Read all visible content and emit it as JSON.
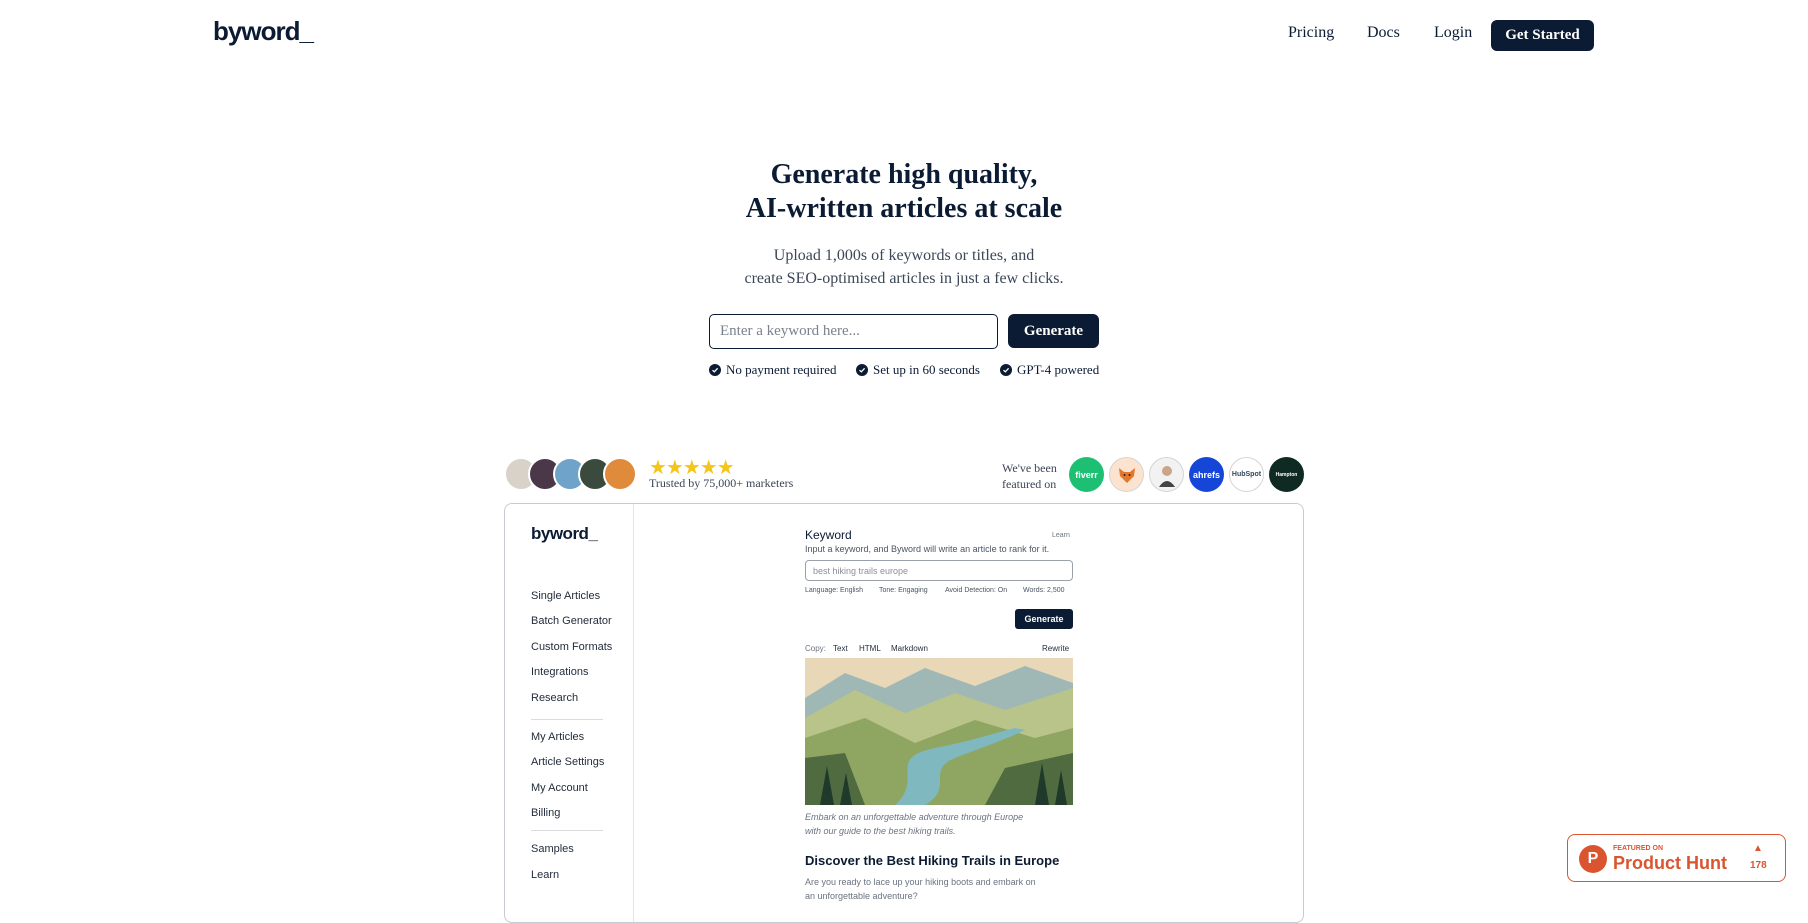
{
  "header": {
    "logo": "byword_",
    "nav": {
      "pricing": "Pricing",
      "docs": "Docs",
      "login": "Login"
    },
    "cta": "Get Started"
  },
  "hero": {
    "title_line1": "Generate high quality,",
    "title_line2": "AI-written articles at scale",
    "subtitle_line1": "Upload 1,000s of keywords or titles, and",
    "subtitle_line2": "create SEO-optimised articles in just a few clicks.",
    "input_placeholder": "Enter a keyword here...",
    "button": "Generate",
    "features": [
      "No payment required",
      "Set up in 60 seconds",
      "GPT-4 powered"
    ]
  },
  "social_proof": {
    "rating_stars": 5,
    "stars": "★★★★★",
    "trusted": "Trusted by 75,000+ marketers",
    "featured_line1": "We've been",
    "featured_line2": "featured on",
    "badges": {
      "fiverr": "fiverr",
      "ahrefs": "ahrefs",
      "hubspot": "HubSpot",
      "hampton": "Hampton"
    }
  },
  "mockup": {
    "logo": "byword_",
    "sidebar": {
      "group1": [
        "Single Articles",
        "Batch Generator",
        "Custom Formats",
        "Integrations",
        "Research"
      ],
      "group2": [
        "My Articles",
        "Article Settings",
        "My Account",
        "Billing"
      ],
      "group3": [
        "Samples",
        "Learn"
      ]
    },
    "keyword_label": "Keyword",
    "learn": "Learn",
    "keyword_desc": "Input a keyword, and Byword will write an article to rank for it.",
    "keyword_value": "best hiking trails europe",
    "options": {
      "language": "Language: English",
      "tone": "Tone: Engaging",
      "avoid": "Avoid Detection: On",
      "words": "Words: 2,500"
    },
    "generate": "Generate",
    "copy": {
      "label": "Copy:",
      "text": "Text",
      "html": "HTML",
      "markdown": "Markdown",
      "rewrite": "Rewrite"
    },
    "caption_line1": "Embark on an unforgettable adventure through Europe",
    "caption_line2": "with our guide to the best hiking trails.",
    "article_heading": "Discover the Best Hiking Trails in Europe",
    "article_para_line1": "Are you ready to lace up your hiking boots and embark on",
    "article_para_line2": "an unforgettable adventure?"
  },
  "product_hunt": {
    "featured": "FEATURED ON",
    "name": "Product Hunt",
    "count": "178"
  },
  "colors": {
    "navy": "#0b1b33",
    "star": "#f5c518",
    "product_hunt": "#da552f"
  }
}
